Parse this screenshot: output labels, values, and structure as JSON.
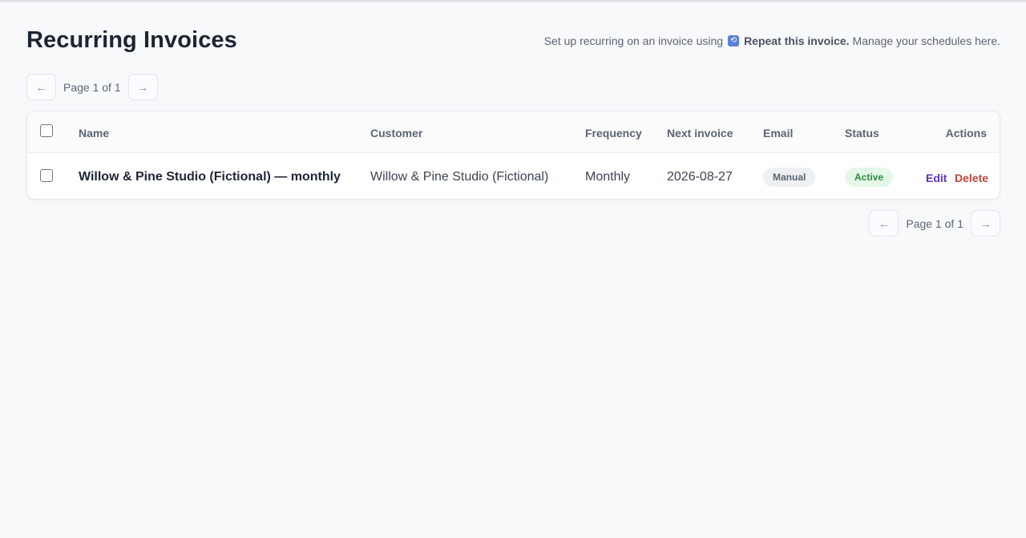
{
  "page": {
    "title": "Recurring Invoices",
    "hint": {
      "prefix": "Set up recurring on an invoice using",
      "icon": "repeat-icon",
      "action": "Repeat this invoice.",
      "suffix": "Manage your schedules here."
    }
  },
  "pager": {
    "prev": "←",
    "next": "→",
    "label": "Page 1 of 1"
  },
  "table": {
    "headers": {
      "name": "Name",
      "customer": "Customer",
      "frequency": "Frequency",
      "next_invoice": "Next invoice",
      "email": "Email",
      "status": "Status",
      "actions": "Actions"
    },
    "rows": [
      {
        "name": "Willow & Pine Studio (Fictional) — monthly",
        "customer": "Willow & Pine Studio (Fictional)",
        "frequency": "Monthly",
        "next_invoice": "2026-08-27",
        "email": "Manual",
        "status": "Active",
        "edit": "Edit",
        "delete": "Delete"
      }
    ]
  },
  "colors": {
    "accent": "#5b33c4",
    "danger": "#c2443c",
    "active_bg": "#e4f7e8",
    "active_text": "#2e8a44"
  }
}
